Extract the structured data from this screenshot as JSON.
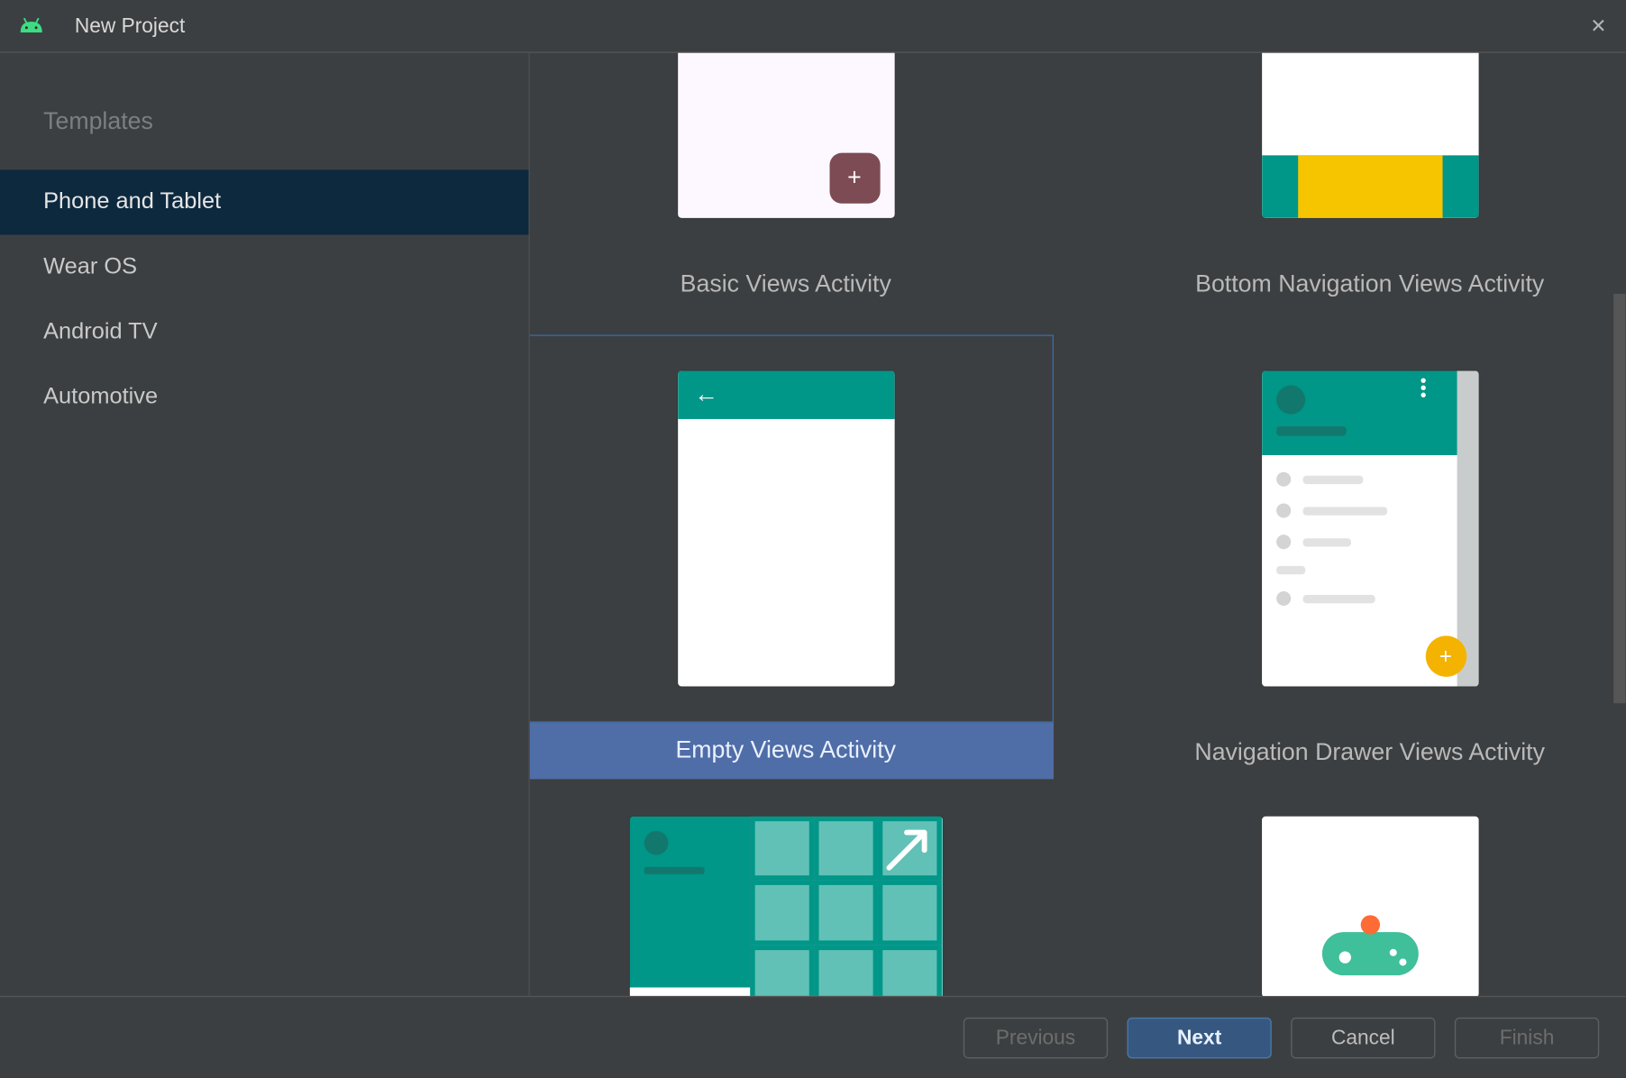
{
  "window": {
    "title": "New Project"
  },
  "sidebar": {
    "heading": "Templates",
    "items": [
      {
        "label": "Phone and Tablet",
        "selected": true
      },
      {
        "label": "Wear OS",
        "selected": false
      },
      {
        "label": "Android TV",
        "selected": false
      },
      {
        "label": "Automotive",
        "selected": false
      }
    ]
  },
  "templates": [
    {
      "label": "Basic Views Activity",
      "selected": false,
      "kind": "basic"
    },
    {
      "label": "Bottom Navigation Views Activity",
      "selected": false,
      "kind": "bottomnav"
    },
    {
      "label": "Empty Views Activity",
      "selected": true,
      "kind": "empty"
    },
    {
      "label": "Navigation Drawer Views Activity",
      "selected": false,
      "kind": "navdrawer"
    },
    {
      "label": "",
      "selected": false,
      "kind": "fullscreen"
    },
    {
      "label": "",
      "selected": false,
      "kind": "gamecontroller"
    }
  ],
  "footer": {
    "previous": "Previous",
    "next": "Next",
    "cancel": "Cancel",
    "finish": "Finish"
  },
  "icons": {
    "fab_plus": "+",
    "back_arrow": "←",
    "close": "✕",
    "fab_plus_small": "+"
  }
}
